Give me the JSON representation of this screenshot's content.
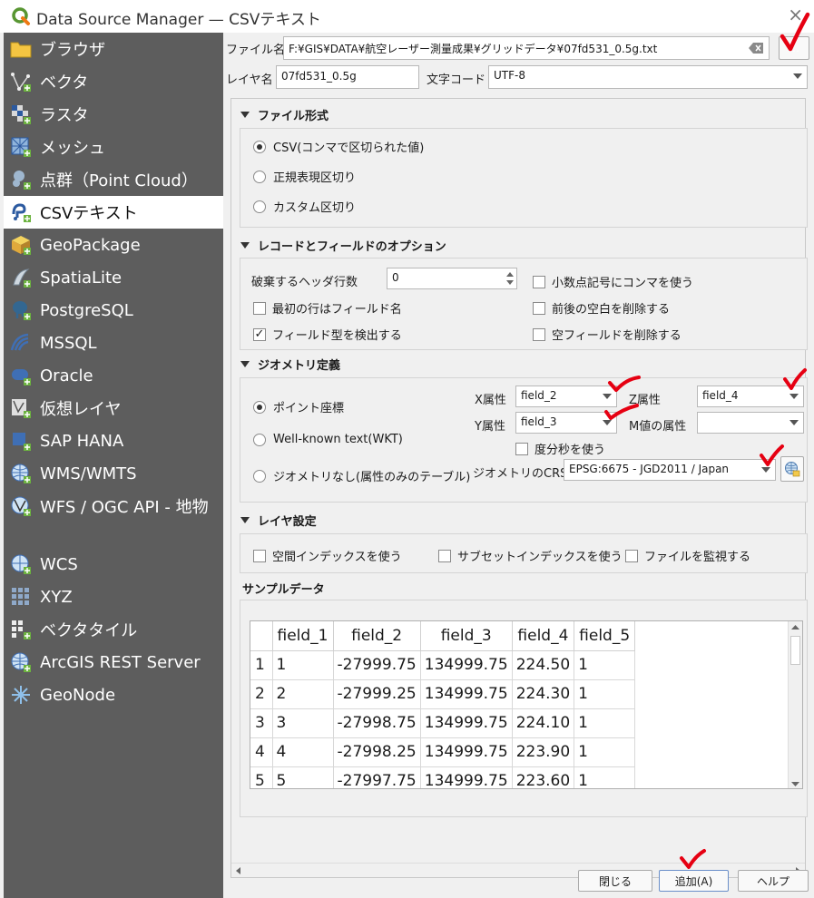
{
  "window": {
    "title": "Data Source Manager — CSVテキスト",
    "close_glyph": "×"
  },
  "sidebar": {
    "items": [
      {
        "label": "ブラウザ",
        "icon": "folder-icon"
      },
      {
        "label": "ベクタ",
        "icon": "vector-icon"
      },
      {
        "label": "ラスタ",
        "icon": "raster-icon"
      },
      {
        "label": "メッシュ",
        "icon": "mesh-icon"
      },
      {
        "label": "点群（Point Cloud）",
        "icon": "point-cloud-icon"
      },
      {
        "label": "CSVテキスト",
        "icon": "csv-icon",
        "selected": true
      },
      {
        "label": "GeoPackage",
        "icon": "geopackage-icon"
      },
      {
        "label": "SpatiaLite",
        "icon": "spatialite-icon"
      },
      {
        "label": "PostgreSQL",
        "icon": "postgresql-icon"
      },
      {
        "label": "MSSQL",
        "icon": "mssql-icon"
      },
      {
        "label": "Oracle",
        "icon": "oracle-icon"
      },
      {
        "label": "仮想レイヤ",
        "icon": "virtual-layer-icon"
      },
      {
        "label": "SAP HANA",
        "icon": "sap-hana-icon"
      },
      {
        "label": "WMS/WMTS",
        "icon": "wms-icon"
      },
      {
        "label": "WFS / OGC API - 地物",
        "icon": "wfs-icon"
      },
      {
        "label": "WCS",
        "icon": "wcs-icon"
      },
      {
        "label": "XYZ",
        "icon": "xyz-icon"
      },
      {
        "label": "ベクタタイル",
        "icon": "vector-tile-icon"
      },
      {
        "label": "ArcGIS REST Server",
        "icon": "arcgis-icon"
      },
      {
        "label": "GeoNode",
        "icon": "geonode-icon"
      }
    ]
  },
  "file": {
    "label": "ファイル名",
    "value": "F:¥GIS¥DATA¥航空レーザー測量成果¥グリッドデータ¥07fd531_0.5g.txt",
    "browse_label": "…"
  },
  "layer": {
    "label": "レイヤ名",
    "value": "07fd531_0.5g",
    "encoding_label": "文字コード",
    "encoding_value": "UTF-8"
  },
  "file_format": {
    "header": "ファイル形式",
    "options": [
      "CSV(コンマで区切られた値)",
      "正規表現区切り",
      "カスタム区切り"
    ],
    "selected": 0
  },
  "record_options": {
    "header": "レコードとフィールドのオプション",
    "skip_header_label": "破棄するヘッダ行数",
    "skip_header_value": "0",
    "first_row_names": "最初の行はフィールド名",
    "detect_types": "フィールド型を検出する",
    "decimal_comma": "小数点記号にコンマを使う",
    "trim_fields": "前後の空白を削除する",
    "discard_empty": "空フィールドを削除する",
    "check_mark": "✓"
  },
  "geometry": {
    "header": "ジオメトリ定義",
    "point_label": "ポイント座標",
    "wkt_label": "Well-known text(WKT)",
    "none_label": "ジオメトリなし(属性のみのテーブル)",
    "x_label": "X属性",
    "x_value": "field_2",
    "y_label": "Y属性",
    "y_value": "field_3",
    "z_label": "Z属性",
    "z_value": "field_4",
    "m_label": "M値の属性",
    "m_value": "",
    "dms_label": "度分秒を使う",
    "crs_label": "ジオメトリのCRS",
    "crs_value": "EPSG:6675 - JGD2011 / Japan"
  },
  "layer_settings": {
    "header": "レイヤ設定",
    "spatial_index": "空間インデックスを使う",
    "subset_index": "サブセットインデックスを使う",
    "watch_file": "ファイルを監視する"
  },
  "sample": {
    "header": "サンプルデータ",
    "columns": [
      "field_1",
      "field_2",
      "field_3",
      "field_4",
      "field_5"
    ],
    "rows": [
      [
        "1",
        "1",
        "-27999.75",
        "134999.75",
        "224.50",
        "1"
      ],
      [
        "2",
        "2",
        "-27999.25",
        "134999.75",
        "224.30",
        "1"
      ],
      [
        "3",
        "3",
        "-27998.75",
        "134999.75",
        "224.10",
        "1"
      ],
      [
        "4",
        "4",
        "-27998.25",
        "134999.75",
        "223.90",
        "1"
      ],
      [
        "5",
        "5",
        "-27997.75",
        "134999.75",
        "223.60",
        "1"
      ]
    ]
  },
  "buttons": {
    "close": "閉じる",
    "add": "追加(A)",
    "help": "ヘルプ"
  },
  "colors": {
    "sidebar_bg": "#5d5d5d",
    "annotation_red": "#e60012"
  }
}
